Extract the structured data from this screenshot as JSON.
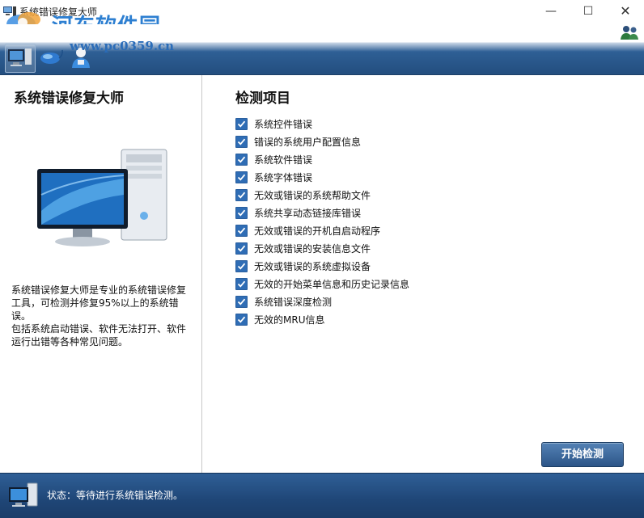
{
  "window": {
    "title": "系统错误修复大师",
    "minimize": "—",
    "maximize": "☐",
    "close": "✕"
  },
  "watermark": {
    "site_name": "河东软件园",
    "url": "www.pc0359.cn"
  },
  "toolbar": {
    "items": [
      {
        "icon": "monitor-icon",
        "active": true
      },
      {
        "icon": "mouse-icon",
        "active": false
      },
      {
        "icon": "user-icon",
        "active": false
      }
    ],
    "help_icon": "help-people-icon"
  },
  "left_panel": {
    "heading": "系统错误修复大师",
    "description_1": "系统错误修复大师是专业的系统错误修复工具，可检测并修复95%以上的系统错误。",
    "description_2": "包括系统启动错误、软件无法打开、软件运行出错等各种常见问题。"
  },
  "right_panel": {
    "heading": "检测项目",
    "items": [
      {
        "label": "系统控件错误",
        "checked": true
      },
      {
        "label": "错误的系统用户配置信息",
        "checked": true
      },
      {
        "label": "系统软件错误",
        "checked": true
      },
      {
        "label": "系统字体错误",
        "checked": true
      },
      {
        "label": "无效或错误的系统帮助文件",
        "checked": true
      },
      {
        "label": "系统共享动态链接库错误",
        "checked": true
      },
      {
        "label": "无效或错误的开机自启动程序",
        "checked": true
      },
      {
        "label": "无效或错误的安装信息文件",
        "checked": true
      },
      {
        "label": "无效或错误的系统虚拟设备",
        "checked": true
      },
      {
        "label": "无效的开始菜单信息和历史记录信息",
        "checked": true
      },
      {
        "label": "系统错误深度检测",
        "checked": true
      },
      {
        "label": "无效的MRU信息",
        "checked": true
      }
    ],
    "start_button": "开始检测"
  },
  "status": {
    "text": "状态：等待进行系统错误检测。"
  },
  "colors": {
    "accent": "#2f6db5",
    "toolbar_dark": "#244f80",
    "statusbar": "#1f4677"
  }
}
